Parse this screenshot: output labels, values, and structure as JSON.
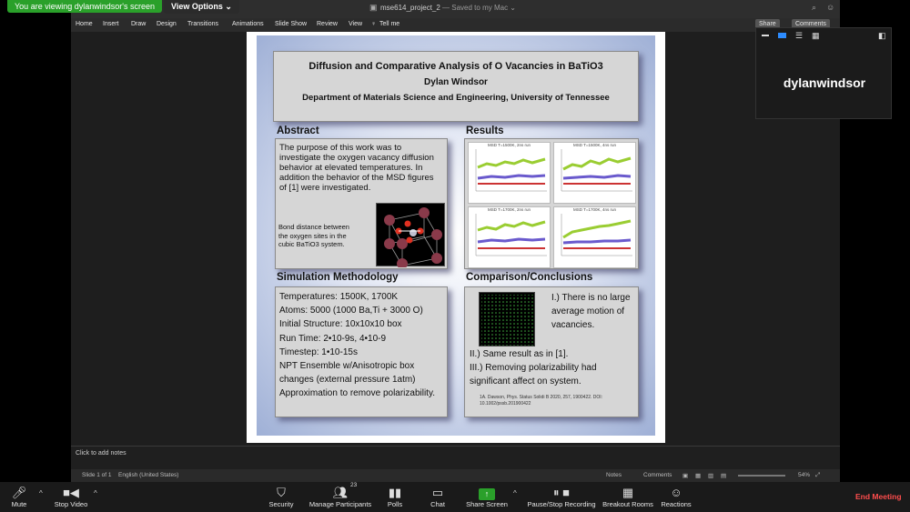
{
  "zoom": {
    "viewing_banner": "You are viewing dylanwindsor's screen",
    "view_options": "View Options ⌄",
    "participant_name": "dylanwindsor",
    "participant_count": "23",
    "end_meeting": "End Meeting",
    "toolbar": {
      "mute": "Mute",
      "stop_video": "Stop Video",
      "security": "Security",
      "participants": "Manage Participants",
      "polls": "Polls",
      "chat": "Chat",
      "share_screen": "Share Screen",
      "recording": "Pause/Stop Recording",
      "breakout": "Breakout Rooms",
      "reactions": "Reactions"
    }
  },
  "ppt": {
    "doc_title": "mse614_project_2",
    "doc_saved": " — Saved to my Mac ⌄",
    "ribbon_tabs": [
      "Home",
      "Insert",
      "Draw",
      "Design",
      "Transitions",
      "Animations",
      "Slide Show",
      "Review",
      "View",
      "Tell me"
    ],
    "share": "Share",
    "comments": "Comments",
    "notes_placeholder": "Click to add notes",
    "status": {
      "slide": "Slide 1 of 1",
      "language": "English (United States)",
      "notes": "Notes",
      "comments": "Comments",
      "zoom": "54%"
    }
  },
  "poster": {
    "title": "Diffusion and Comparative Analysis of O Vacancies in BaTiO3",
    "author": "Dylan Windsor",
    "affiliation": "Department of Materials Science and Engineering, University of Tennessee",
    "abstract_head": "Abstract",
    "abstract_text": "The purpose of this work was to investigate the oxygen vacancy diffusion behavior at elevated temperatures.  In addition the behavior of the MSD figures of [1] were investigated.",
    "abstract_caption": "Bond distance between the oxygen sites in the cubic BaTiO3 system.",
    "results_head": "Results",
    "plot_titles": [
      "MSD T=1500K, 2ns run",
      "MSD T=1500K, 4ns run",
      "MSD T=1700K, 2ns run",
      "MSD T=1700K, 4ns run"
    ],
    "method_head": "Simulation Methodology",
    "method_lines": [
      "Temperatures: 1500K, 1700K",
      "Atoms: 5000 (1000 Ba,Ti + 3000 O)",
      "Initial Structure: 10x10x10 box",
      "Run Time: 2•10-9s, 4•10-9",
      "Timestep: 1•10-15s",
      "NPT Ensemble w/Anisotropic box changes (external pressure 1atm)",
      "Approximation to remove polarizability."
    ],
    "conclusion_head": "Comparison/Conclusions",
    "conclusion_1": "I.) There is no large average motion of vacancies.",
    "conclusion_2": "II.) Same result as in [1].",
    "conclusion_3": "III.) Removing polarizability had significant affect on system.",
    "reference": "1A. Dawson, Phys. Status Solidi B 2020, 257, 1900422. DOI: 10.1002/pssb.201900422"
  },
  "colors": {
    "zoom_green": "#2aa02a",
    "end_meeting_red": "#ff4d4d",
    "poster_box": "#d6d6d6",
    "series_green": "#9acd32",
    "series_purple": "#6a5acd",
    "series_red": "#cc3333"
  }
}
